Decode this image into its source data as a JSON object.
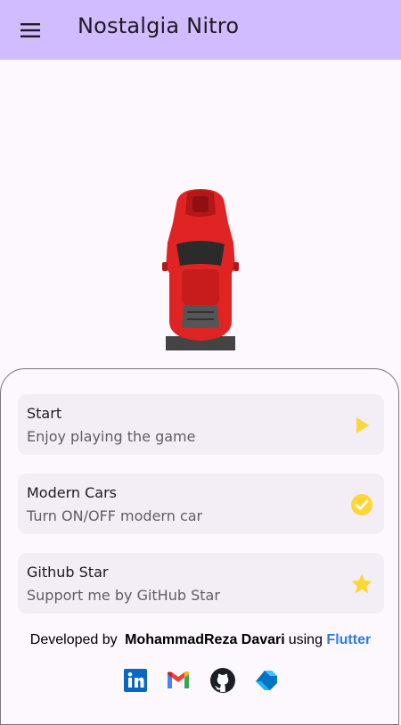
{
  "app": {
    "title": "Nostalgia Nitro",
    "accent_color": "#d0bcff"
  },
  "menu": {
    "items": [
      {
        "title": "Start",
        "subtitle": "Enjoy playing the game",
        "icon": "play-icon"
      },
      {
        "title": "Modern Cars",
        "subtitle": "Turn ON/OFF modern car",
        "icon": "check-circle-icon"
      },
      {
        "title": "Github Star",
        "subtitle": "Support me by GitHub Star",
        "icon": "star-icon"
      }
    ]
  },
  "footer": {
    "prefix": "Developed by",
    "author": "MohammadReza Davari",
    "middle": "using",
    "framework": "Flutter",
    "links": [
      "linkedin-icon",
      "gmail-icon",
      "github-icon",
      "dart-icon"
    ]
  }
}
